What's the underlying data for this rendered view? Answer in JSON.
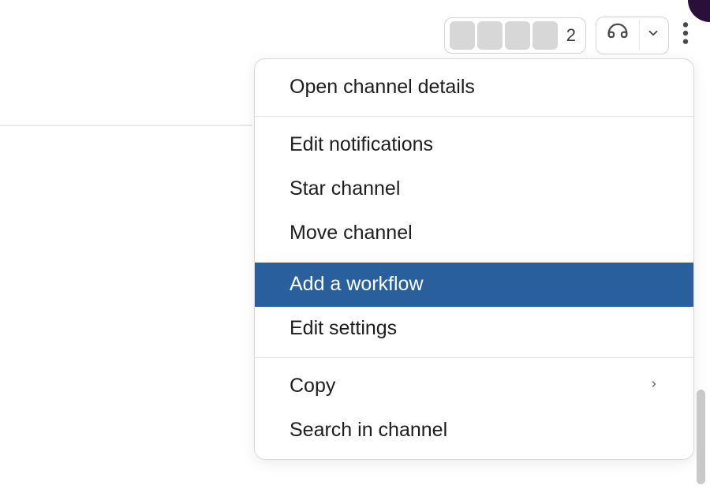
{
  "header": {
    "member_count": "2"
  },
  "menu": {
    "section1": [
      {
        "label": "Open channel details",
        "highlighted": false
      }
    ],
    "section2": [
      {
        "label": "Edit notifications",
        "highlighted": false
      },
      {
        "label": "Star channel",
        "highlighted": false
      },
      {
        "label": "Move channel",
        "highlighted": false
      }
    ],
    "section3": [
      {
        "label": "Add a workflow",
        "highlighted": true
      },
      {
        "label": "Edit settings",
        "highlighted": false
      }
    ],
    "section4": [
      {
        "label": "Copy",
        "highlighted": false,
        "has_submenu": true
      },
      {
        "label": "Search in channel",
        "highlighted": false
      }
    ]
  },
  "colors": {
    "highlight": "#2a5f9e"
  }
}
